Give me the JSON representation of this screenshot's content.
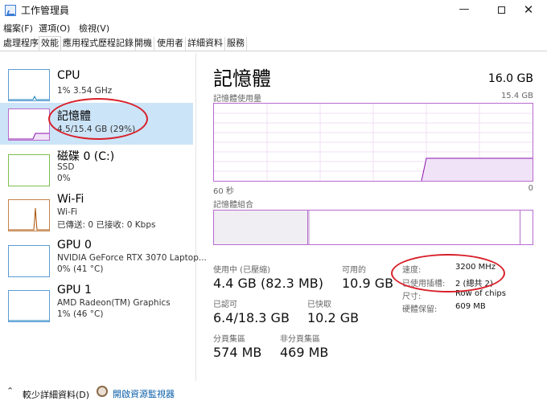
{
  "window": {
    "title": "工作管理員",
    "minimize_icon": "minimize-icon",
    "maximize_icon": "maximize-icon",
    "close_icon": "close-icon"
  },
  "menu": {
    "items": [
      "檔案(F)",
      "選項(O)",
      "檢視(V)"
    ]
  },
  "tabs": [
    "處理程序",
    "效能",
    "應用程式歷程記錄",
    "開機",
    "使用者",
    "詳細資料",
    "服務"
  ],
  "active_tab": "效能",
  "sidebar": {
    "items": [
      {
        "name": "CPU",
        "line1": "1%  3.54 GHz",
        "line2": "",
        "color": "#117dbb"
      },
      {
        "name": "記憶體",
        "line1": "4.5/15.4 GB (29%)",
        "line2": "",
        "color": "#8b12ae"
      },
      {
        "name": "磁碟 0 (C:)",
        "line1": "SSD",
        "line2": "0%",
        "color": "#4da60c"
      },
      {
        "name": "Wi-Fi",
        "line1": "Wi-Fi",
        "line2": "已傳送: 0 已接收: 0 Kbps",
        "color": "#a74f01"
      },
      {
        "name": "GPU 0",
        "line1": "NVIDIA GeForce RTX 3070 Laptop...",
        "line2": "0% (41 °C)",
        "color": "#117dbb"
      },
      {
        "name": "GPU 1",
        "line1": "AMD Radeon(TM) Graphics",
        "line2": "1% (46 °C)",
        "color": "#117dbb"
      }
    ]
  },
  "memory": {
    "title": "記憶體",
    "total": "16.0 GB",
    "usage_label": "記憶體使用量",
    "usage_max": "15.4 GB",
    "time_left": "60 秒",
    "time_right": "0",
    "composition_label": "記憶體組合",
    "in_use_label": "使用中 (已壓縮)",
    "in_use_value": "4.4 GB (82.3 MB)",
    "available_label": "可用的",
    "available_value": "10.9 GB",
    "committed_label": "已認可",
    "committed_value": "6.4/18.3 GB",
    "cached_label": "已快取",
    "cached_value": "10.2 GB",
    "paged_label": "分頁集區",
    "paged_value": "574 MB",
    "nonpaged_label": "非分頁集區",
    "nonpaged_value": "469 MB",
    "details": [
      {
        "label": "速度:",
        "value": "3200 MHz"
      },
      {
        "label": "已使用插槽:",
        "value": "2 (總共 2)"
      },
      {
        "label": "尺寸:",
        "value": "Row of chips"
      },
      {
        "label": "硬體保留:",
        "value": "609 MB"
      }
    ],
    "color": "#8b12ae",
    "usage_fraction_recent": 0.29
  },
  "footer": {
    "fewer_details": "較少詳細資料(D)",
    "resource_monitor": "開啟資源監視器"
  },
  "annotation_color": "#d8202a"
}
